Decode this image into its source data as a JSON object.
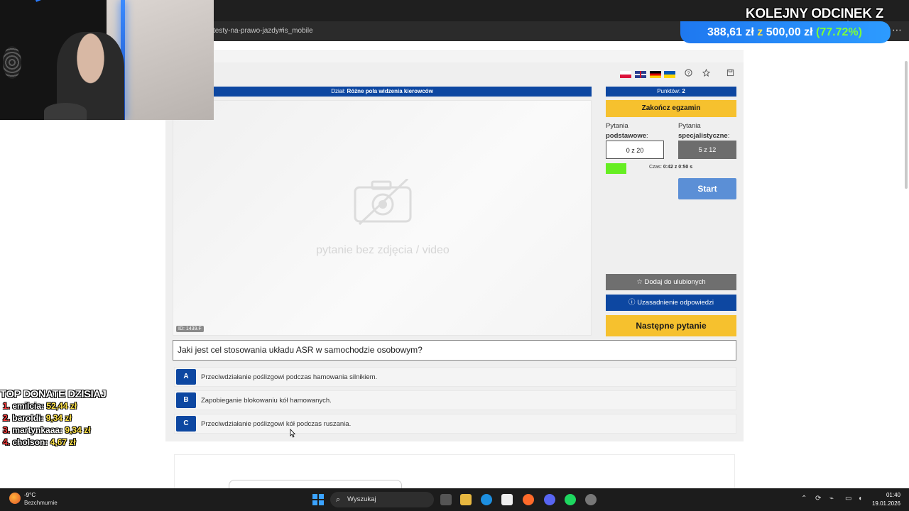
{
  "browser": {
    "url": "testy-na-prawo-jazdy#is_mobile",
    "menu_icon": "ellipsis-icon"
  },
  "toolbar": {
    "flags": [
      "pl",
      "en",
      "de",
      "ua"
    ],
    "icons": [
      "help-icon",
      "star-icon",
      "save-icon"
    ]
  },
  "exam": {
    "category_prefix": "Dział:",
    "category_name": "Różne pola widzenia kierowców",
    "media_placeholder": "pytanie bez zdjęcia / video",
    "media_id": "ID: 1439.F",
    "points_label": "Punktów:",
    "points_value": "2",
    "finish_label": "Zakończ egzamin",
    "basic_label_1": "Pytania",
    "basic_label_2": "podstawowe",
    "spec_label_1": "Pytania",
    "spec_label_2": "specjalistyczne",
    "basic_count": "0 z 20",
    "spec_count": "5 z 12",
    "timer_label": "Czas:",
    "timer_value": "0:42 z 0:50 s",
    "timer_fraction": 0.16,
    "start_label": "Start",
    "favorite_label": "Dodaj do ulubionych",
    "explanation_label": "Uzasadnienie odpowiedzi",
    "next_label": "Następne pytanie",
    "question": "Jaki jest cel stosowania układu ASR w samochodzie osobowym?",
    "answers": [
      {
        "letter": "A",
        "text": "Przeciwdziałanie poślizgowi podczas hamowania silnikiem."
      },
      {
        "letter": "B",
        "text": "Zapobieganie blokowaniu kół hamowanych."
      },
      {
        "letter": "C",
        "text": "Przeciwdziałanie poślizgowi kół podczas ruszania."
      }
    ]
  },
  "overlay": {
    "goal_title": "KOLEJNY ODCINEK Z GOŚCIEM",
    "goal_current": "388,61 zł",
    "goal_of": "z",
    "goal_target": "500,00 zł",
    "goal_percent": "(77.72%)",
    "donate_title": "TOP DONATE DZISIAJ",
    "donors": [
      {
        "rank": "1.",
        "name": "emilcia",
        "amount": "52,44 zł"
      },
      {
        "rank": "2.",
        "name": "baroldi",
        "amount": "9,34 zł"
      },
      {
        "rank": "3.",
        "name": "martynkaaa",
        "amount": "9,34 zł"
      },
      {
        "rank": "4.",
        "name": "cholson",
        "amount": "4,67 zł"
      }
    ]
  },
  "taskbar": {
    "temperature": "-9°C",
    "weather": "Bezchmurnie",
    "search_placeholder": "Wyszukaj",
    "time": "01:40",
    "date": "19.01.2026"
  }
}
